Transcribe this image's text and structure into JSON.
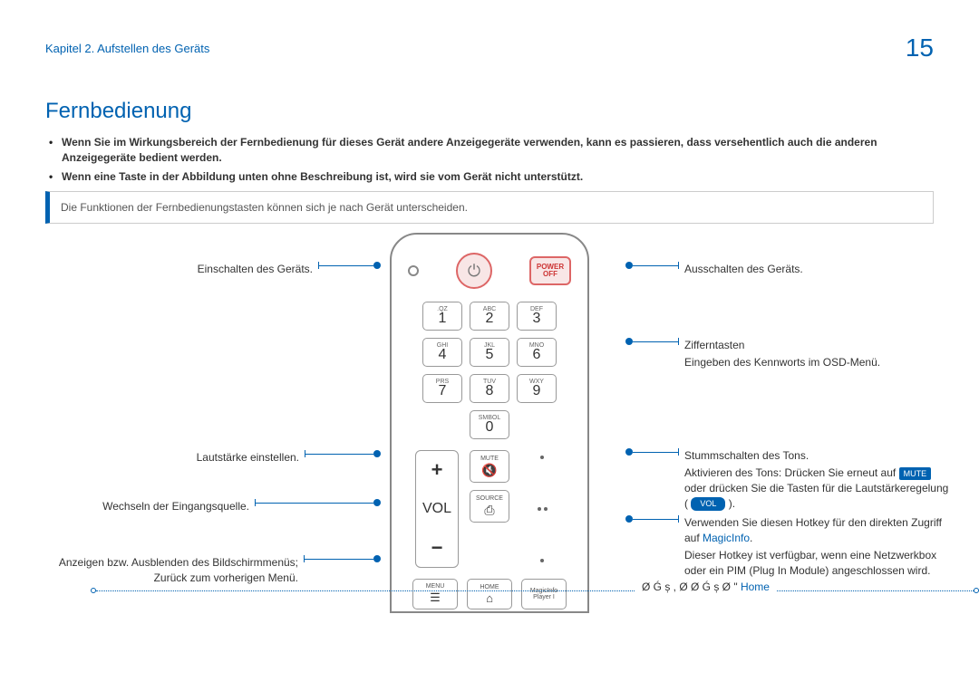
{
  "header": {
    "chapter": "Kapitel 2. Aufstellen des Geräts",
    "page": "15"
  },
  "section": {
    "title": "Fernbedienung"
  },
  "intro": {
    "bullet1": "Wenn Sie im Wirkungsbereich der Fernbedienung für dieses Gerät andere Anzeigegeräte verwenden, kann es passieren, dass versehentlich auch die anderen Anzeigegeräte bedient werden.",
    "bullet2": "Wenn eine Taste in der Abbildung unten ohne Beschreibung ist, wird sie vom Gerät nicht unterstützt."
  },
  "info_box": "Die Funktionen der Fernbedienungstasten können sich je nach Gerät unterscheiden.",
  "remote": {
    "power_off_top": "POWER",
    "power_off_bot": "OFF",
    "keys": {
      "k1_sub": ".QZ",
      "k1": "1",
      "k2_sub": "ABC",
      "k2": "2",
      "k3_sub": "DEF",
      "k3": "3",
      "k4_sub": "GHI",
      "k4": "4",
      "k5_sub": "JKL",
      "k5": "5",
      "k6_sub": "MNO",
      "k6": "6",
      "k7_sub": "PRS",
      "k7": "7",
      "k8_sub": "TUV",
      "k8": "8",
      "k9_sub": "WXY",
      "k9": "9",
      "k0_sub": "SMBOL",
      "k0": "0"
    },
    "vol_label": "VOL",
    "mute_label": "MUTE",
    "source_label": "SOURCE",
    "menu_label": "MENU",
    "home_label": "HOME",
    "magicinfo_label1": "MagicInfo",
    "magicinfo_label2": "Player I"
  },
  "labels_left": {
    "l1": "Einschalten des Geräts.",
    "l2": "Lautstärke einstellen.",
    "l3": "Wechseln der Eingangsquelle.",
    "l4": "Anzeigen bzw. Ausblenden des Bildschirmmenüs; Zurück zum vorherigen Menü."
  },
  "labels_right": {
    "r1": "Ausschalten des Geräts.",
    "r2a": "Zifferntasten",
    "r2b": "Eingeben des Kennworts im OSD-Menü.",
    "r3a": "Stummschalten des Tons.",
    "r3b_pre": "Aktivieren des Tons: Drücken Sie erneut auf ",
    "r3b_mute": "MUTE",
    "r3b_mid": " oder drücken Sie die Tasten für die Lautstärkeregelung ( ",
    "r3b_vol": "VOL",
    "r3b_post": " ).",
    "r4a": "Verwenden Sie diesen Hotkey für den direkten Zugriff auf ",
    "r4a_link": "MagicInfo",
    "r4b": "Dieser Hotkey ist verfügbar, wenn eine Netzwerkbox oder ein PIM (Plug In Module) angeschlossen wird."
  },
  "footer": {
    "gtext": "Ø Ǵ  ș , Ø Ø Ǵ  ș  Ø  \"  ",
    "home": "Home"
  }
}
